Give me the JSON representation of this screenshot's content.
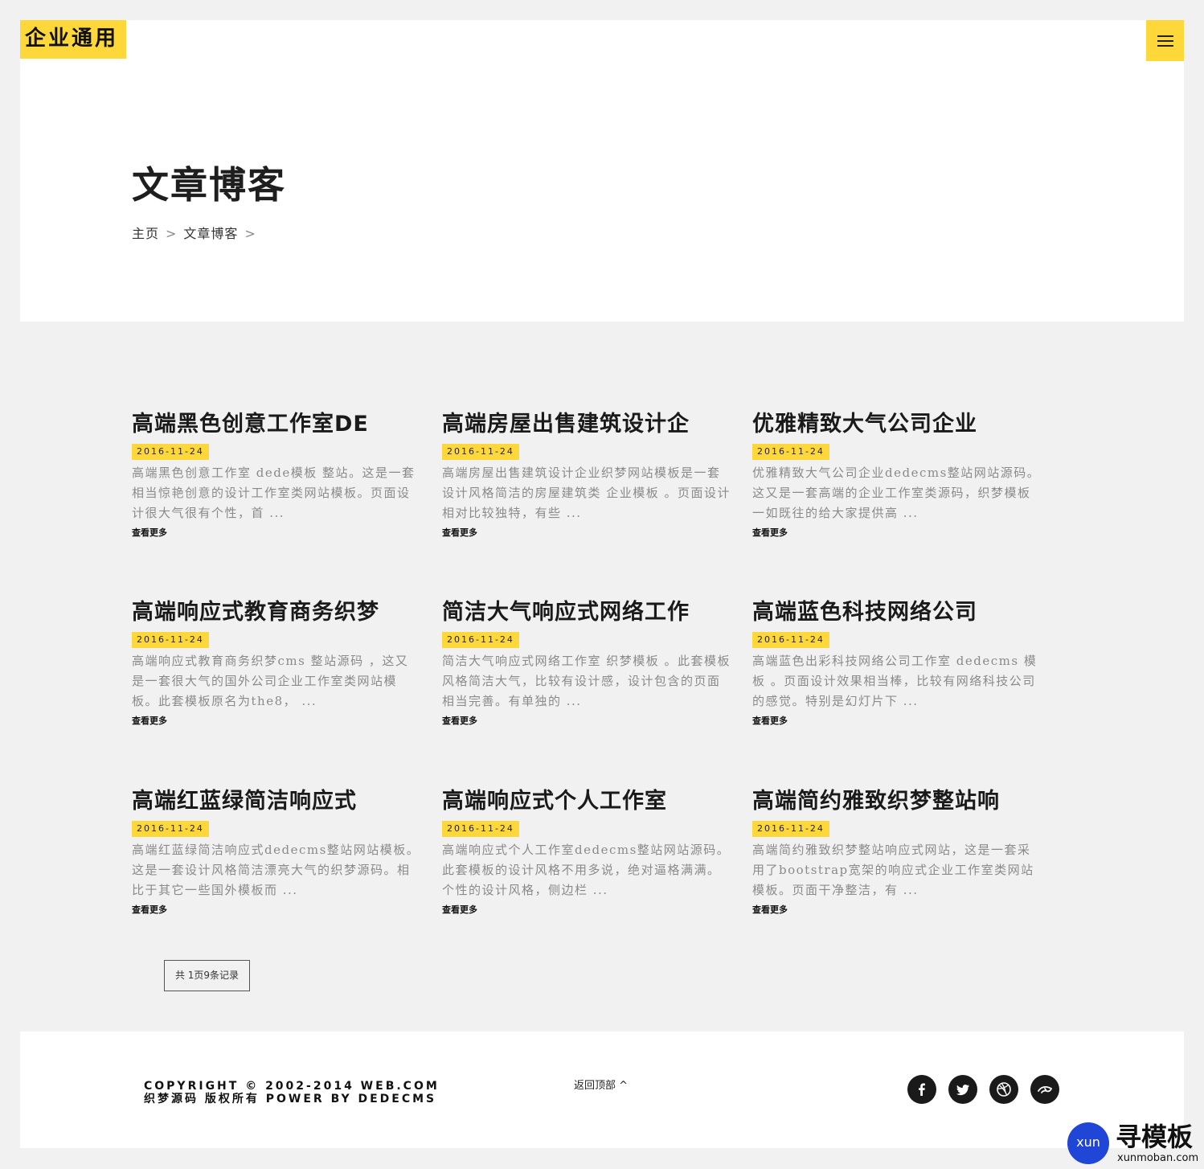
{
  "header": {
    "logo": "企业通用",
    "page_title": "文章博客",
    "breadcrumb": [
      "主页",
      "文章博客"
    ],
    "breadcrumb_sep": ">"
  },
  "posts": [
    {
      "title": "高端黑色创意工作室DE",
      "date": "2016-11-24",
      "excerpt": "高端黑色创意工作室 dede模板 整站。这是一套相当惊艳创意的设计工作室类网站模板。页面设计很大气很有个性，首 ...",
      "more": "查看更多"
    },
    {
      "title": "高端房屋出售建筑设计企",
      "date": "2016-11-24",
      "excerpt": "高端房屋出售建筑设计企业织梦网站模板是一套设计风格简洁的房屋建筑类 企业模板 。页面设计相对比较独特，有些 ...",
      "more": "查看更多"
    },
    {
      "title": "优雅精致大气公司企业",
      "date": "2016-11-24",
      "excerpt": "优雅精致大气公司企业dedecms整站网站源码。这又是一套高端的企业工作室类源码，织梦模板一如既往的给大家提供高 ...",
      "more": "查看更多"
    },
    {
      "title": "高端响应式教育商务织梦",
      "date": "2016-11-24",
      "excerpt": "高端响应式教育商务织梦cms 整站源码 ，这又是一套很大气的国外公司企业工作室类网站模板。此套模板原名为the8， ...",
      "more": "查看更多"
    },
    {
      "title": "简洁大气响应式网络工作",
      "date": "2016-11-24",
      "excerpt": "简洁大气响应式网络工作室 织梦模板 。此套模板风格简洁大气，比较有设计感，设计包含的页面相当完善。有单独的 ...",
      "more": "查看更多"
    },
    {
      "title": "高端蓝色科技网络公司",
      "date": "2016-11-24",
      "excerpt": "高端蓝色出彩科技网络公司工作室 dedecms 模板 。页面设计效果相当棒，比较有网络科技公司的感觉。特别是幻灯片下 ...",
      "more": "查看更多"
    },
    {
      "title": "高端红蓝绿简洁响应式",
      "date": "2016-11-24",
      "excerpt": "高端红蓝绿简洁响应式dedecms整站网站模板。这是一套设计风格简洁漂亮大气的织梦源码。相比于其它一些国外模板而 ...",
      "more": "查看更多"
    },
    {
      "title": "高端响应式个人工作室",
      "date": "2016-11-24",
      "excerpt": "高端响应式个人工作室dedecms整站网站源码。此套模板的设计风格不用多说，绝对逼格满满。个性的设计风格，侧边栏 ...",
      "more": "查看更多"
    },
    {
      "title": "高端简约雅致织梦整站响",
      "date": "2016-11-24",
      "excerpt": "高端简约雅致织梦整站响应式网站，这是一套采用了bootstrap宽架的响应式企业工作室类网站模板。页面干净整洁，有 ...",
      "more": "查看更多"
    }
  ],
  "pager": "共 1页9条记录",
  "footer": {
    "copyright": "COPYRIGHT © 2002-2014 WEB.COM 织梦源码 版权所有 POWER BY DEDECMS",
    "back_to_top": "返回顶部 ^",
    "socials": [
      "facebook-icon",
      "twitter-icon",
      "dribbble-icon",
      "deviantart-icon"
    ]
  },
  "watermark": {
    "badge": "xun",
    "text": "寻模板",
    "url": "xunmoban.com"
  },
  "colors": {
    "accent": "#fed83b",
    "background": "#f1f1f1"
  }
}
